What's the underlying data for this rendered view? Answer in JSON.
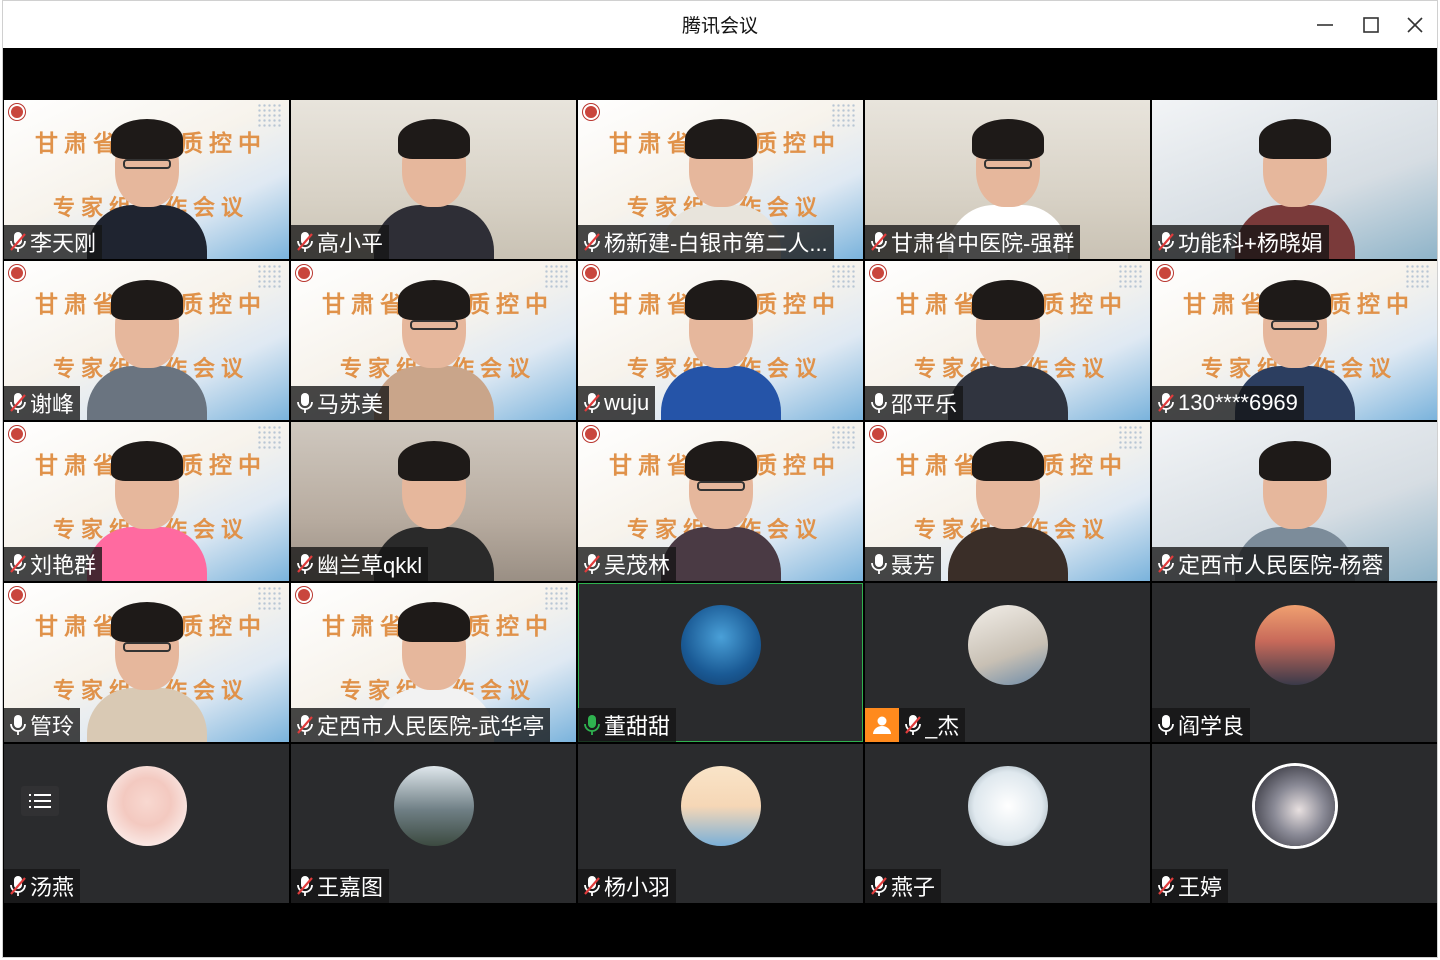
{
  "window": {
    "title": "腾讯会议",
    "controls": [
      "minimize-icon",
      "maximize-icon",
      "close-icon"
    ]
  },
  "banner": {
    "line1": "甘肃省超声质控中心",
    "line2": "专家组工作会议"
  },
  "participants": [
    {
      "name": "李天刚",
      "mic": "muted",
      "view": "video"
    },
    {
      "name": "高小平",
      "mic": "muted",
      "view": "video"
    },
    {
      "name": "杨新建-白银市第二人...",
      "mic": "muted",
      "view": "video"
    },
    {
      "name": "甘肃省中医院-强群",
      "mic": "muted",
      "view": "video"
    },
    {
      "name": "功能科+杨晓娟",
      "mic": "muted",
      "view": "video"
    },
    {
      "name": "谢峰",
      "mic": "muted",
      "view": "video"
    },
    {
      "name": "马苏美",
      "mic": "on",
      "view": "video"
    },
    {
      "name": "wuju",
      "mic": "muted",
      "view": "video"
    },
    {
      "name": "邵平乐",
      "mic": "on",
      "view": "video"
    },
    {
      "name": "130****6969",
      "mic": "muted",
      "view": "video"
    },
    {
      "name": "刘艳群",
      "mic": "muted",
      "view": "video"
    },
    {
      "name": "幽兰草qkkl",
      "mic": "muted",
      "view": "video"
    },
    {
      "name": "吴茂林",
      "mic": "muted",
      "view": "video"
    },
    {
      "name": "聂芳",
      "mic": "on",
      "view": "video"
    },
    {
      "name": "定西市人民医院-杨蓉",
      "mic": "muted",
      "view": "video"
    },
    {
      "name": "管玲",
      "mic": "on",
      "view": "video"
    },
    {
      "name": "定西市人民医院-武华亭",
      "mic": "muted",
      "view": "video"
    },
    {
      "name": "董甜甜",
      "mic": "speaking",
      "view": "avatar"
    },
    {
      "name": "_杰",
      "mic": "muted",
      "view": "avatar"
    },
    {
      "name": "阎学良",
      "mic": "on",
      "view": "avatar"
    },
    {
      "name": "汤燕",
      "mic": "muted",
      "view": "avatar"
    },
    {
      "name": "王嘉图",
      "mic": "muted",
      "view": "avatar"
    },
    {
      "name": "杨小羽",
      "mic": "muted",
      "view": "avatar"
    },
    {
      "name": "燕子",
      "mic": "muted",
      "view": "avatar"
    },
    {
      "name": "王婷",
      "mic": "muted",
      "view": "avatar"
    }
  ],
  "colors": {
    "muted_icon": "#e03c3c",
    "speaking_icon": "#2fb24f",
    "banner_text": "#e0924a",
    "host_badge": "#ff8a1d"
  }
}
